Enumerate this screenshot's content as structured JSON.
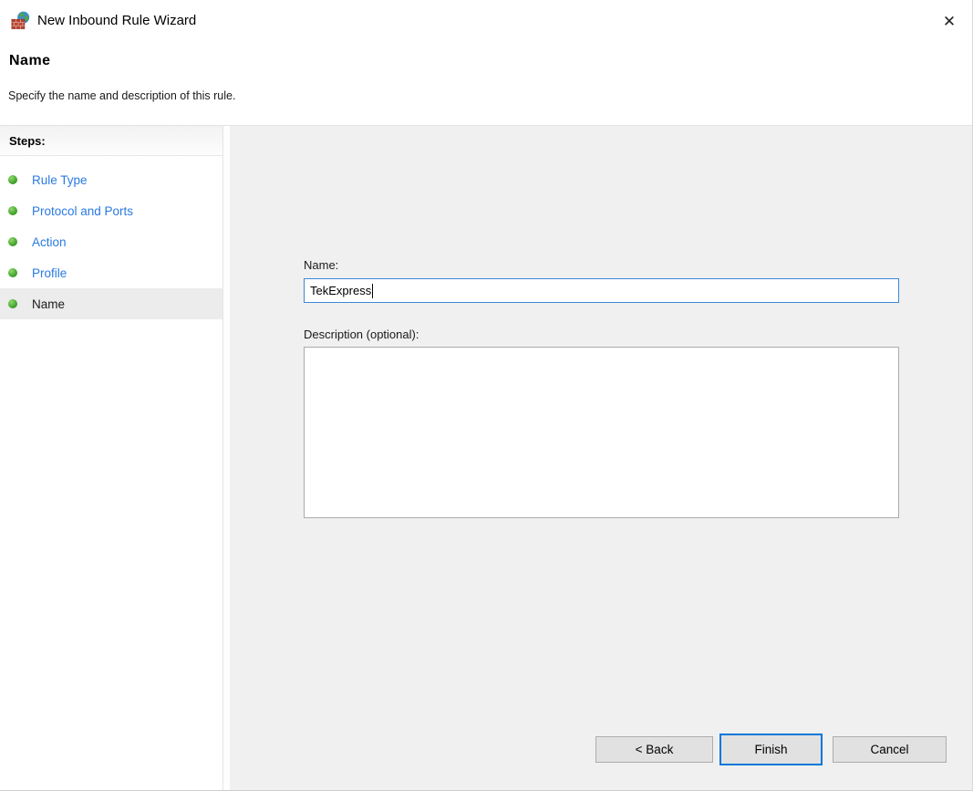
{
  "window": {
    "title": "New Inbound Rule Wizard",
    "close_glyph": "✕"
  },
  "header": {
    "title": "Name",
    "subtitle": "Specify the name and description of this rule."
  },
  "steps_panel": {
    "title": "Steps:",
    "items": [
      {
        "label": "Rule Type",
        "state": "link"
      },
      {
        "label": "Protocol and Ports",
        "state": "link"
      },
      {
        "label": "Action",
        "state": "link"
      },
      {
        "label": "Profile",
        "state": "link"
      },
      {
        "label": "Name",
        "state": "current"
      }
    ]
  },
  "form": {
    "name_label": "Name:",
    "name_value": "TekExpress",
    "description_label": "Description (optional):",
    "description_value": ""
  },
  "buttons": {
    "back": "< Back",
    "finish": "Finish",
    "cancel": "Cancel"
  },
  "colors": {
    "link_blue": "#2a7ae0",
    "focus_blue": "#0078d7",
    "bullet_green": "#45a52e",
    "panel_gray": "#f0f0f0",
    "button_face": "#e1e1e1",
    "button_border": "#adadad"
  }
}
